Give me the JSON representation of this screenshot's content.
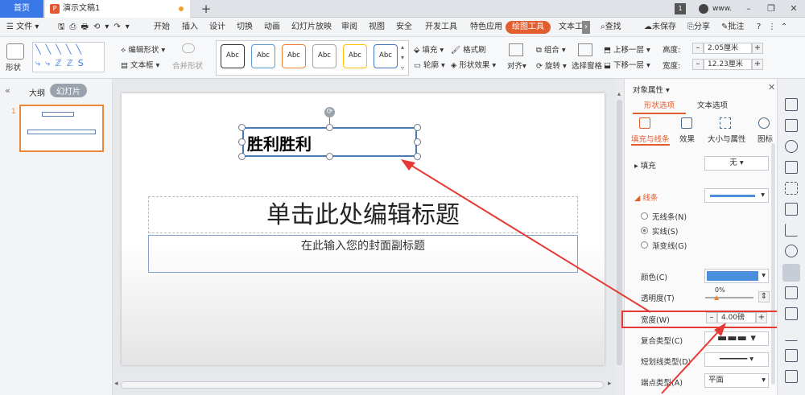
{
  "tabs": {
    "home": "首页",
    "doc": "演示文稿1",
    "add": "+",
    "page_num": "1",
    "user": "www.",
    "minimize": "–",
    "restore": "❐",
    "close": "✕"
  },
  "menu": {
    "file": "文件",
    "items": [
      "开始",
      "插入",
      "设计",
      "切换",
      "动画",
      "幻灯片放映",
      "审阅",
      "视图",
      "安全",
      "开发工具",
      "特色应用"
    ],
    "active": "绘图工具",
    "text_tool": "文本工",
    "find": "查找",
    "unsaved": "未保存",
    "share": "分享",
    "comment": "批注",
    "more": "›",
    "help": "?"
  },
  "ribbon": {
    "shape": "形状",
    "edit_shape": "编辑形状",
    "textbox": "文本框",
    "merge_shape": "合并形状",
    "style_label": "Abc",
    "fill": "填充",
    "format_brush": "格式刷",
    "outline": "轮廓",
    "shape_effect": "形状效果",
    "align": "对齐",
    "group": "组合",
    "rotate": "旋转",
    "selection_pane": "选择窗格",
    "bring_forward": "上移一层",
    "send_backward": "下移一层",
    "height_label": "高度:",
    "height_value": "2.05厘米",
    "width_label": "宽度:",
    "width_value": "12.23厘米",
    "minus": "–",
    "plus": "+"
  },
  "style_colors": [
    "#333333",
    "#5b9bd5",
    "#ed7d31",
    "#a5a5a5",
    "#ffc000",
    "#4472c4"
  ],
  "left_panel": {
    "outline_tab": "大纲",
    "slides_tab": "幻灯片",
    "slide_no": "1",
    "collapse": "«"
  },
  "slide": {
    "textbox_text": "胜利胜利",
    "title_placeholder": "单击此处编辑标题",
    "subtitle_placeholder": "在此输入您的封面副标题"
  },
  "right_panel": {
    "title": "对象属性",
    "tab_shape": "形状选项",
    "tab_text": "文本选项",
    "sub_tabs": [
      "填充与线条",
      "效果",
      "大小与属性",
      "图标"
    ],
    "fill_label": "填充",
    "fill_value": "无",
    "line_label": "线条",
    "radio_none": "无线条(N)",
    "radio_solid": "实线(S)",
    "radio_gradient": "渐变线(G)",
    "color_label": "颜色(C)",
    "color_value": "#4a8fd9",
    "transparency_label": "透明度(T)",
    "transparency_value": "0%",
    "width_label": "宽度(W)",
    "width_value": "4.00磅",
    "compound_label": "复合类型(C)",
    "dash_label": "短划线类型(D)",
    "cap_label": "端点类型(A)",
    "cap_value": "平面"
  },
  "accent": "#e35d2e"
}
